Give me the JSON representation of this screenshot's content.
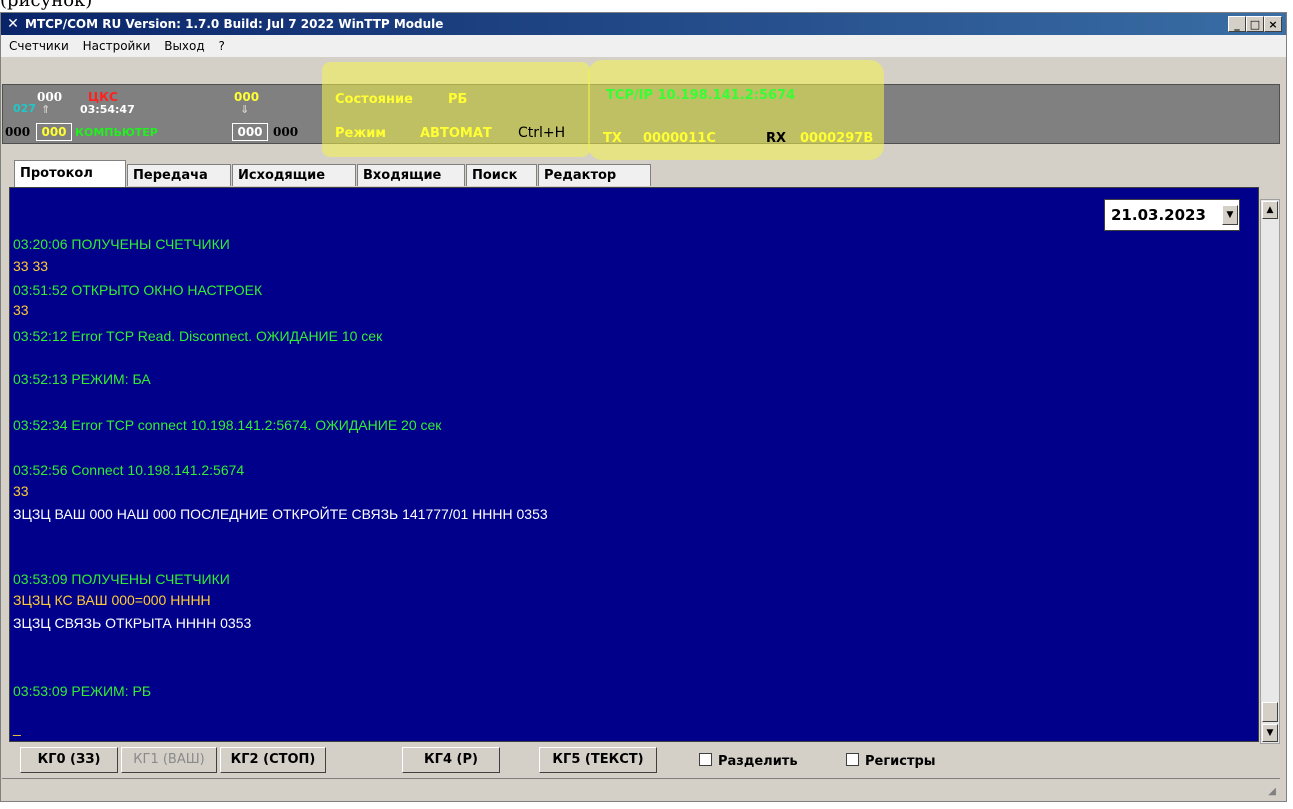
{
  "window": {
    "title": "MTCP/COM RU  Version: 1.7.0 Build: Jul  7 2022  WinTTP Module",
    "app_icon": "x-icon",
    "controls": [
      "_",
      "□",
      "×"
    ]
  },
  "menu": [
    "Счетчики",
    "Настройки",
    "Выход",
    "?"
  ],
  "counters": {
    "top_left_cyan": "027",
    "top_left": "000",
    "label_red": "ЦКС",
    "top_right_yellow": "000",
    "time": "03:54:47",
    "bottom_left": "000",
    "bottom_box_left": "000",
    "label_green": "КОМПЬЮТЕР",
    "bottom_box_right": "000",
    "bottom_right": "000"
  },
  "state": {
    "state_label": "Состояние",
    "state_value": "РБ",
    "mode_label": "Режим",
    "mode_value": "АВТОМАТ",
    "hotkey": "Ctrl+H"
  },
  "connection": {
    "endpoint": "TCP/IP 10.198.141.2:5674",
    "tx_label": "TX",
    "tx_value": "0000011C",
    "rx_label": "RX",
    "rx_value": "0000297B"
  },
  "tabs": [
    "Протокол",
    "Передача",
    "Исходящие",
    "Входящие",
    "Поиск",
    "Редактор"
  ],
  "date": "21.03.2023",
  "log": [
    {
      "text": "03:20:06 ПОЛУЧЕНЫ СЧЕТЧИКИ",
      "color": "#33ee33"
    },
    {
      "text": "33 33",
      "color": "#ffcc33"
    },
    {
      "text": "03:51:52 ОТКРЫТО ОКНО НАСТРОЕК",
      "color": "#33ee33"
    },
    {
      "text": "33",
      "color": "#ffcc33"
    },
    {
      "text": "03:52:12 Error TCP Read. Disconnect. ОЖИДАНИЕ 10 сек",
      "color": "#33ee33"
    },
    {
      "text": "03:52:13 РЕЖИМ: БА",
      "color": "#33ee33"
    },
    {
      "text": "03:52:34 Error TCP connect 10.198.141.2:5674. ОЖИДАНИЕ 20 сек",
      "color": "#33ee33"
    },
    {
      "text": "03:52:56 Connect 10.198.141.2:5674",
      "color": "#33ee33"
    },
    {
      "text": "33",
      "color": "#ffcc33"
    },
    {
      "text": "ЗЦЗЦ ВАШ 000 НАШ 000 ПОСЛЕДНИЕ ОТКРОЙТЕ СВЯЗЬ 141777/01 НННН  0353",
      "color": "#ffffff"
    },
    {
      "text": "03:53:09 ПОЛУЧЕНЫ СЧЕТЧИКИ",
      "color": "#33ee33"
    },
    {
      "text": "ЗЦЗЦ КС ВАШ 000=000 НННН",
      "color": "#ffcc33"
    },
    {
      "text": "ЗЦЗЦ СВЯЗЬ ОТКРЫТА НННН  0353",
      "color": "#ffffff"
    },
    {
      "text": "03:53:09 РЕЖИМ: РБ",
      "color": "#33ee33"
    },
    {
      "text": "_",
      "color": "#ffcc33"
    }
  ],
  "buttons": [
    "КГ0 (ЗЗ)",
    "КГ1 (ВАШ)",
    "КГ2 (СТОП)",
    "КГ4 (Р)",
    "КГ5 (ТЕКСТ)"
  ],
  "checkboxes": [
    "Разделить",
    "Регистры"
  ],
  "highlight_color": "#f2f24c"
}
